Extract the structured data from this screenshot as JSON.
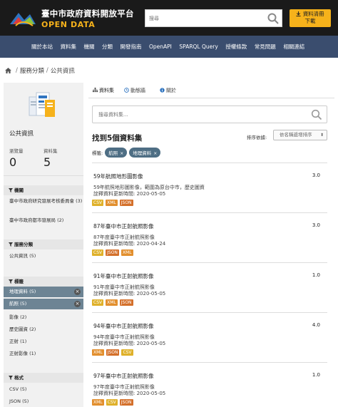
{
  "header": {
    "title": "臺中市政府資料開放平台",
    "subtitle": "OPEN DATA",
    "search_placeholder": "搜尋",
    "download_line1": "資料清冊",
    "download_line2": "下載"
  },
  "nav": [
    "關於本站",
    "資料集",
    "機關",
    "分類",
    "開發指南",
    "OpenAPI",
    "SPARQL Query",
    "授權條款",
    "常見問題",
    "相關連結"
  ],
  "breadcrumb": [
    "服務分類",
    "公共資訊"
  ],
  "sidebar": {
    "org_name": "公共資訊",
    "stat1_label": "瀏覽量",
    "stat1_value": "0",
    "stat2_label": "資料集",
    "stat2_value": "5",
    "facet_org": "機關",
    "org_items": [
      "臺中市政府研究發展考核委員會 (3)",
      "臺中市政府都市發展局 (2)"
    ],
    "facet_cat": "服務分類",
    "cat_items": [
      "公共資訊 (5)"
    ],
    "facet_tag": "標籤",
    "tag_active": [
      "地理資料 (5)",
      "航照 (5)"
    ],
    "tag_items": [
      "影像 (2)",
      "歷史圖資 (2)",
      "正射 (1)",
      "正射影像 (1)"
    ],
    "facet_fmt": "格式",
    "fmt_items": [
      "CSV (5)",
      "JSON (5)"
    ]
  },
  "content": {
    "tabs": [
      "資料集",
      "動態牆",
      "關於"
    ],
    "search_placeholder": "搜尋資料集...",
    "found": "找到5個資料集",
    "sort_label": "排序依據:",
    "sort_value": "依名稱遞增排序",
    "tags_label": "標籤:",
    "tags": [
      "航照",
      "地理資料"
    ],
    "datasets": [
      {
        "title": "59年航照地形圖影像",
        "version": "3.0",
        "desc1": "59年航照地形圖影像，範圍為原台中市，歷史圖資",
        "desc2": "詮釋資料更新時間: 2020-05-05",
        "formats": [
          "CSV",
          "XML",
          "JSON"
        ]
      },
      {
        "title": "87年臺中市正射航照影像",
        "version": "3.0",
        "desc1": "87年度臺中市正射航照影像",
        "desc2": "詮釋資料更新時間: 2020-04-24",
        "formats": [
          "CSV",
          "JSON",
          "XML"
        ]
      },
      {
        "title": "91年臺中市正射航照影像",
        "version": "1.0",
        "desc1": "91年度臺中市正射航照影像",
        "desc2": "詮釋資料更新時間: 2020-05-05",
        "formats": [
          "CSV",
          "XML",
          "JSON"
        ]
      },
      {
        "title": "94年臺中市正射航照影像",
        "version": "4.0",
        "desc1": "94年度臺中市正射航照影像",
        "desc2": "詮釋資料更新時間: 2020-05-05",
        "formats": [
          "XML",
          "JSON",
          "CSV"
        ]
      },
      {
        "title": "97年臺中市正射航照影像",
        "version": "1.0",
        "desc1": "97年度臺中市正射航照影像",
        "desc2": "詮釋資料更新時間: 2020-05-05",
        "formats": [
          "XML",
          "CSV",
          "JSON"
        ]
      }
    ]
  }
}
